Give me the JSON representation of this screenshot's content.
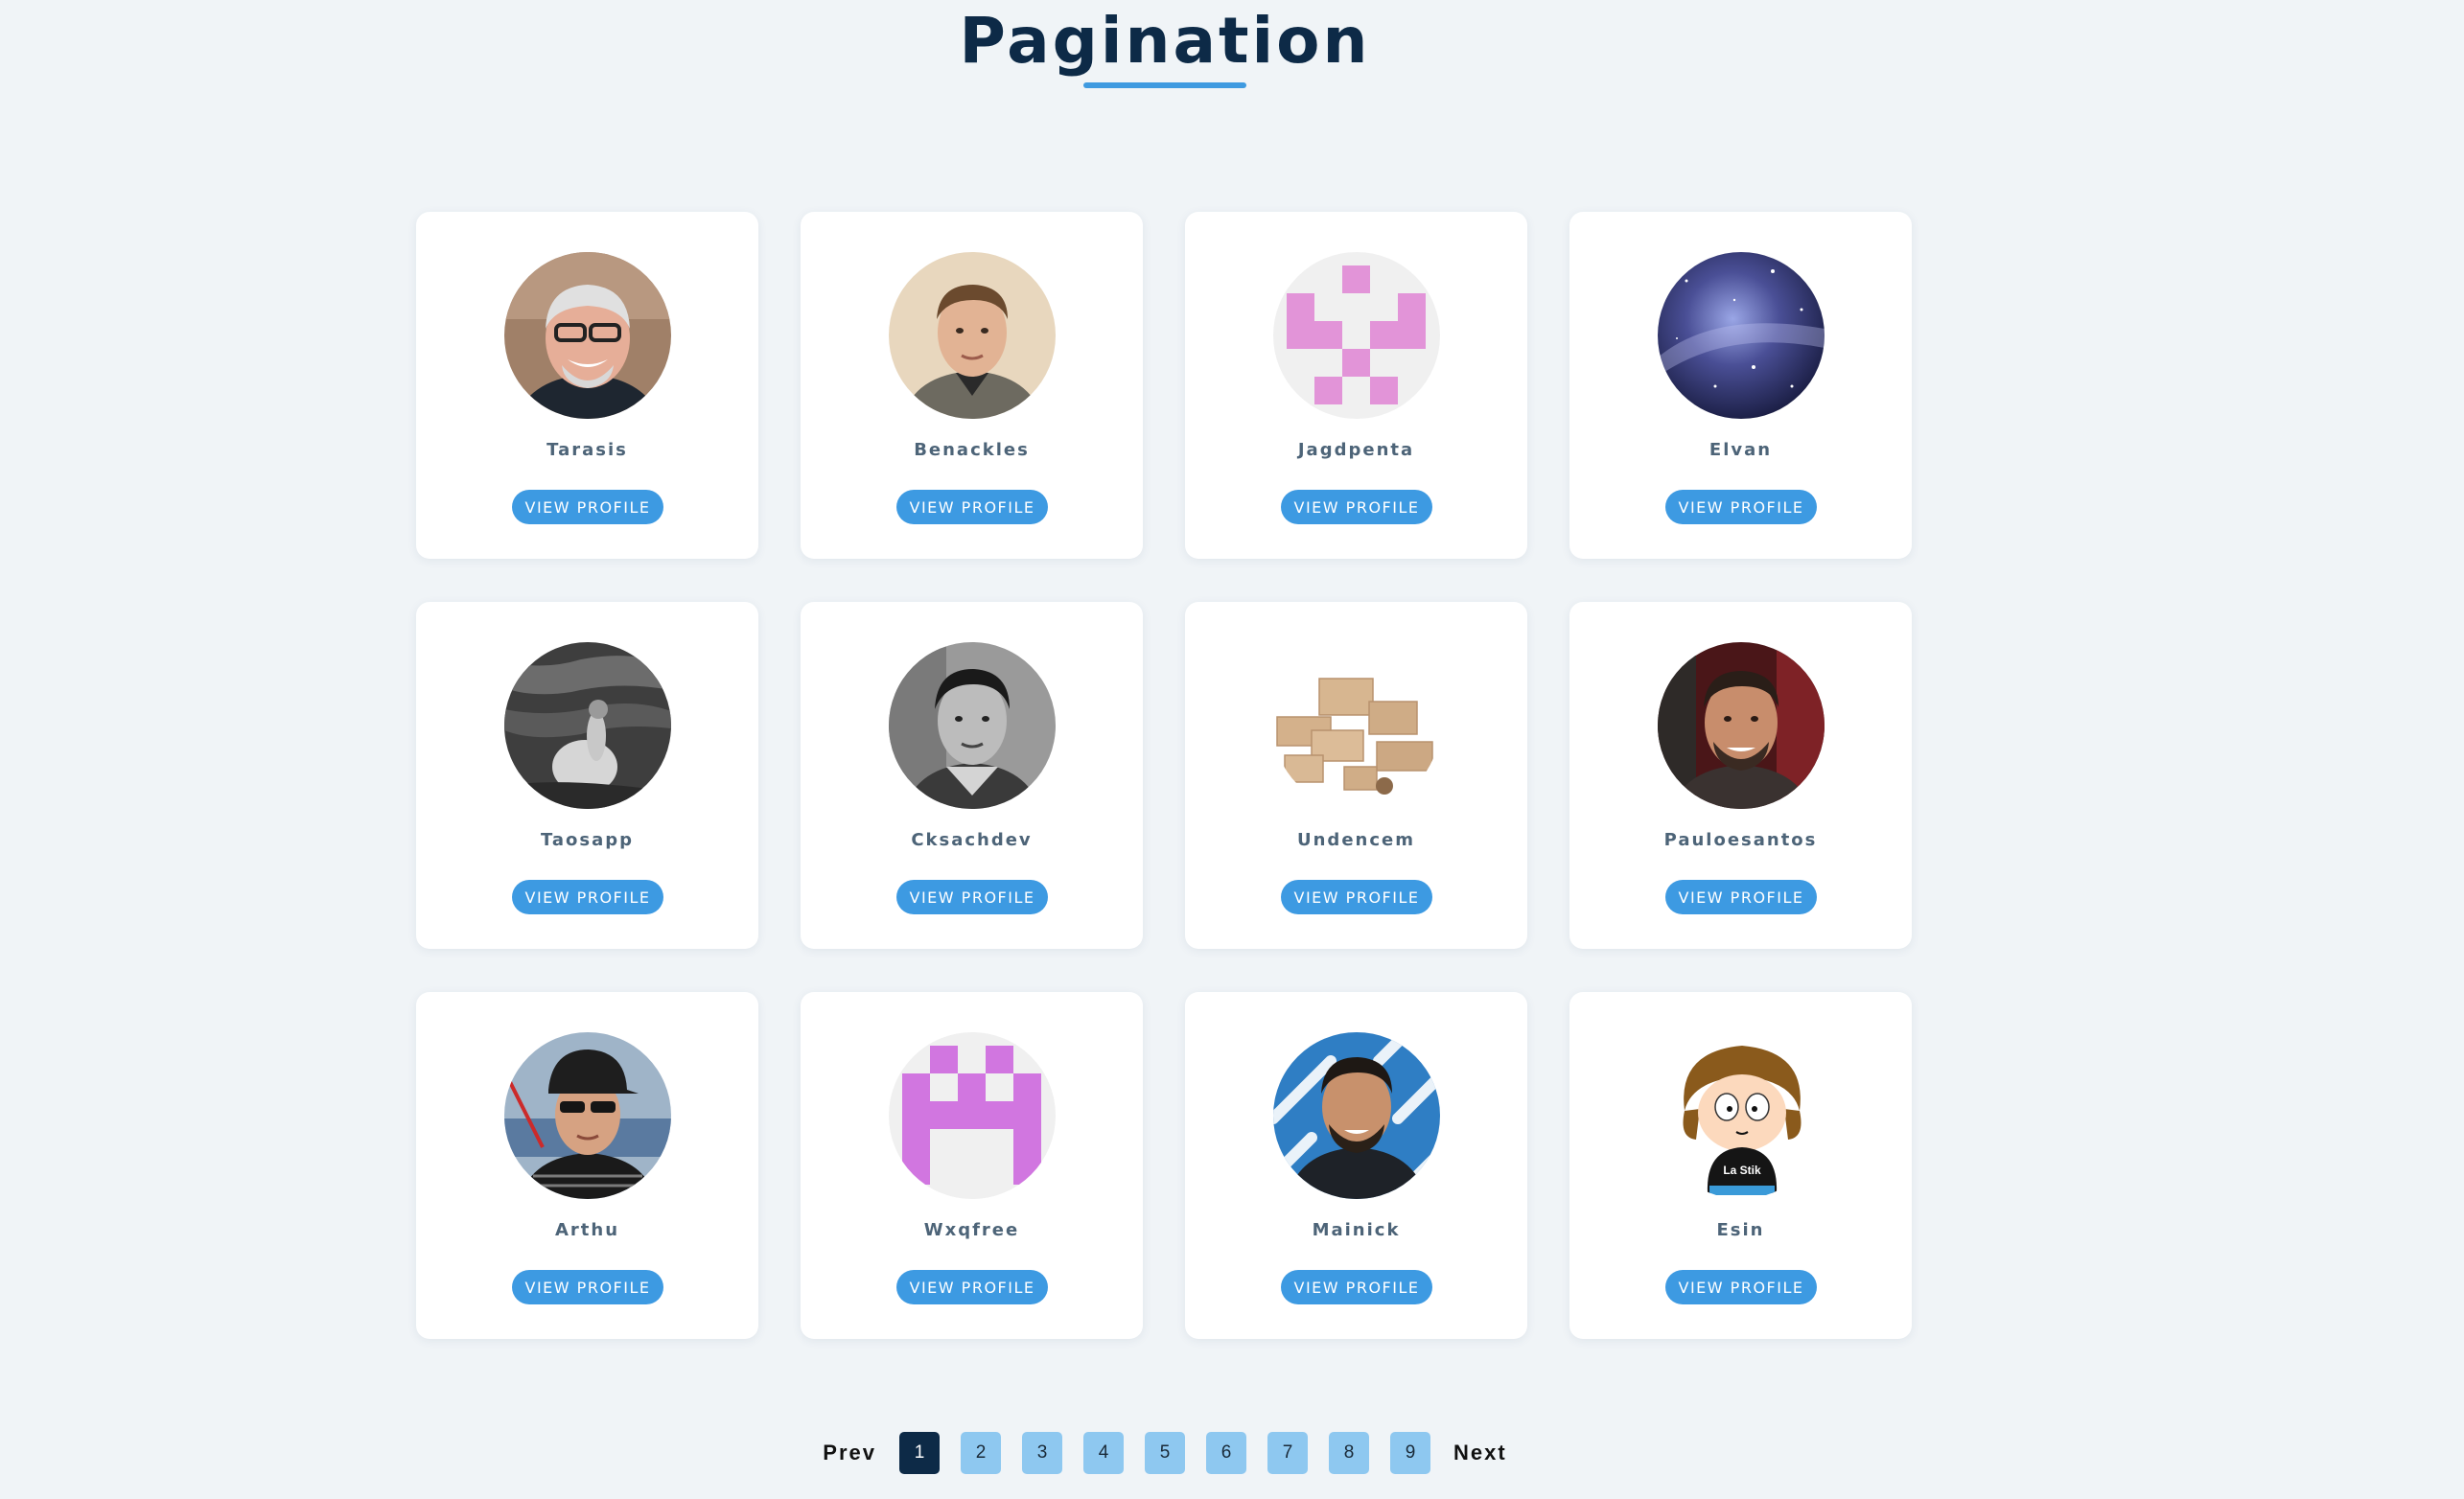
{
  "header": {
    "title": "Pagination"
  },
  "button_label": "VIEW PROFILE",
  "colors": {
    "background": "#f0f4f7",
    "title": "#0d2a47",
    "accent": "#3d9ae2",
    "page_inactive": "#8ec8f0",
    "page_active": "#0d2a47",
    "name_text": "#4d6478"
  },
  "users": [
    {
      "name": "Tarasis",
      "avatar": "photo-older-man-glasses"
    },
    {
      "name": "Benackles",
      "avatar": "photo-young-man"
    },
    {
      "name": "Jagdpenta",
      "avatar": "identicon-pink"
    },
    {
      "name": "Elvan",
      "avatar": "galaxy-image"
    },
    {
      "name": "Taosapp",
      "avatar": "bw-photo-water"
    },
    {
      "name": "Cksachdev",
      "avatar": "bw-portrait-man"
    },
    {
      "name": "Undencem",
      "avatar": "cardboard-boxes"
    },
    {
      "name": "Pauloesantos",
      "avatar": "photo-bearded-man"
    },
    {
      "name": "Arthu",
      "avatar": "photo-man-cap-sunglasses"
    },
    {
      "name": "Wxqfree",
      "avatar": "identicon-purple"
    },
    {
      "name": "Mainick",
      "avatar": "photo-man-blue-pattern"
    },
    {
      "name": "Esin",
      "avatar": "cartoon-character",
      "avatar_text": "La Stik"
    }
  ],
  "pagination": {
    "prev": "Prev",
    "next": "Next",
    "pages": [
      "1",
      "2",
      "3",
      "4",
      "5",
      "6",
      "7",
      "8",
      "9"
    ],
    "current": "1"
  }
}
